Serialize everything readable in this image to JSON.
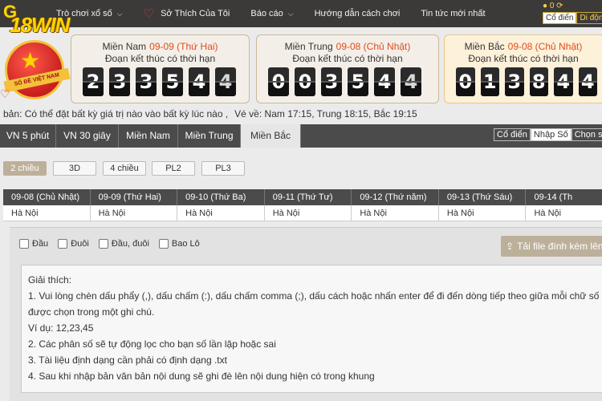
{
  "nav": {
    "items": [
      {
        "label": "Trò chơi xổ số"
      },
      {
        "label": "Sở Thích Của Tôi"
      },
      {
        "label": "Báo cáo"
      },
      {
        "label": "Hướng dẫn cách chơi"
      },
      {
        "label": "Tin tức mới nhất"
      }
    ]
  },
  "user": {
    "balance": "0",
    "mode_tabs": [
      "Cổ điển",
      "Di độn"
    ]
  },
  "logo": {
    "brand_text": "18WIN",
    "brand_prefix": "G",
    "badge_text": "SỔ ĐỀ VIỆT NAM"
  },
  "panels": [
    {
      "region": "Miền Nam",
      "date": "09-09 (Thứ Hai)",
      "subtitle": "Đoạn kết thúc có thời hạn",
      "digits": [
        "2",
        "3",
        "3",
        "5",
        "4",
        "4"
      ]
    },
    {
      "region": "Miền Trung",
      "date": "09-08 (Chủ Nhật)",
      "subtitle": "Đoạn kết thúc có thời hạn",
      "digits": [
        "0",
        "0",
        "3",
        "5",
        "4",
        "4"
      ]
    },
    {
      "region": "Miền Bắc",
      "date": "09-08 (Chủ Nhật)",
      "subtitle": "Đoạn kết thúc có thời hạn",
      "digits": [
        "0",
        "1",
        "3",
        "8",
        "4",
        "4"
      ]
    }
  ],
  "info": {
    "note": "bản: Có thể đặt bất kỳ giá trị nào vào bất kỳ lúc nào ,",
    "schedule": "Vé về: Nam 17:15, Trung 18:15, Bắc 19:15"
  },
  "region_tabs": [
    "VN 5 phút",
    "VN 30 giây",
    "Miền Nam",
    "Miền Trung",
    "Miền Bắc"
  ],
  "view_tabs": [
    "Cổ điển",
    "Nhập Số",
    "Chọn số nh"
  ],
  "game_types": [
    "2 chiều",
    "3D",
    "4 chiều",
    "PL2",
    "PL3"
  ],
  "dates": {
    "headers": [
      "09-08 (Chủ Nhật)",
      "09-09 (Thứ Hai)",
      "09-10 (Thứ Ba)",
      "09-11 (Thứ Tư)",
      "09-12 (Thứ năm)",
      "09-13 (Thứ Sáu)",
      "09-14 (Th"
    ],
    "cells": [
      "Hà Nội",
      "Hà Nội",
      "Hà Nội",
      "Hà Nội",
      "Hà Nội",
      "Hà Nội",
      "Hà Nội"
    ]
  },
  "options": [
    "Đầu",
    "Đuôi",
    "Đầu, đuôi",
    "Bao Lô"
  ],
  "upload_label": "Tải file đính kèm lên",
  "explain": {
    "title": "Giải thích:",
    "line1": "1. Vui lòng chèn dấu phẩy (,), dấu chấm (:), dấu chấm comma (;), dấu cách hoặc nhấn enter để đi đến dòng tiếp theo giữa mỗi chữ số được chọn trong một ghi chú.",
    "example": "Ví dụ: 12,23,45",
    "line2": "2. Các phân số sẽ tự động lọc cho bạn số lần lặp hoặc sai",
    "line3": "3. Tài liệu định dạng cần phải có định dạng .txt",
    "line4": "4. Sau khi nhập bản văn bản nội dung sẽ ghi đè lên nội dung hiện có trong khung"
  },
  "colors": {
    "topbar": "#3b3a39",
    "accent_date": "#e34b1a",
    "gold": "#ffd400",
    "region_bar": "#4b4b4b",
    "button_tan": "#bdb09a"
  }
}
